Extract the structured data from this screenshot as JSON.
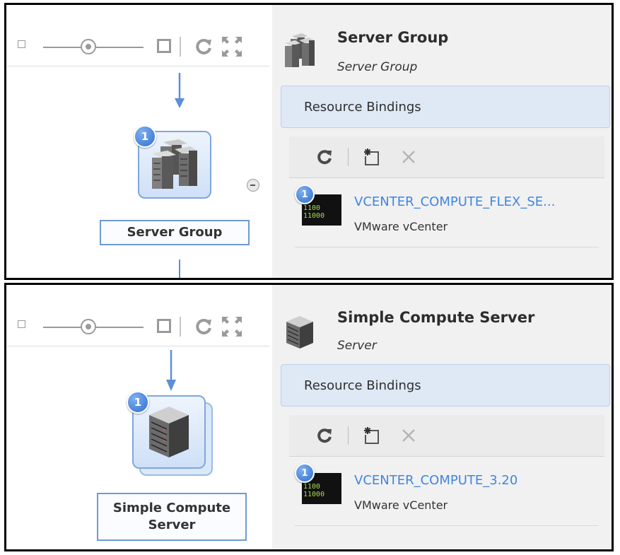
{
  "colors": {
    "accent_blue": "#3f86e0",
    "node_border": "#6f9ad6",
    "bindings_bar_bg": "#dfe8f5",
    "right_pane_bg": "#f1f1f1",
    "bits_green": "#a8d84e"
  },
  "zoom": {
    "level_fraction": 0.45,
    "icons": [
      "zoom-out-icon",
      "zoom-slider",
      "zoom-in-icon",
      "refresh-icon",
      "fit-to-screen-icon"
    ]
  },
  "panels": [
    {
      "node": {
        "badge": "1",
        "label": "Server Group",
        "icon": "server-group-icon"
      },
      "detail": {
        "title": "Server Group",
        "subtitle": "Server Group",
        "icon": "server-group-icon"
      },
      "resource_bindings": {
        "section_label": "Resource Bindings",
        "toolbar_icons": [
          "refresh-icon",
          "new-binding-icon",
          "delete-icon"
        ],
        "items": [
          {
            "badge": "1",
            "name": "VCENTER_COMPUTE_FLEX_SE...",
            "type": "VMware vCenter",
            "thumb_text": "1100\n11000"
          }
        ]
      }
    },
    {
      "node": {
        "badge": "1",
        "label": "Simple Compute Server",
        "icon": "server-icon"
      },
      "detail": {
        "title": "Simple Compute Server",
        "subtitle": "Server",
        "icon": "server-icon"
      },
      "resource_bindings": {
        "section_label": "Resource Bindings",
        "toolbar_icons": [
          "refresh-icon",
          "new-binding-icon",
          "delete-icon"
        ],
        "items": [
          {
            "badge": "1",
            "name": "VCENTER_COMPUTE_3.20",
            "type": "VMware vCenter",
            "thumb_text": "1100\n11000"
          }
        ]
      }
    }
  ]
}
